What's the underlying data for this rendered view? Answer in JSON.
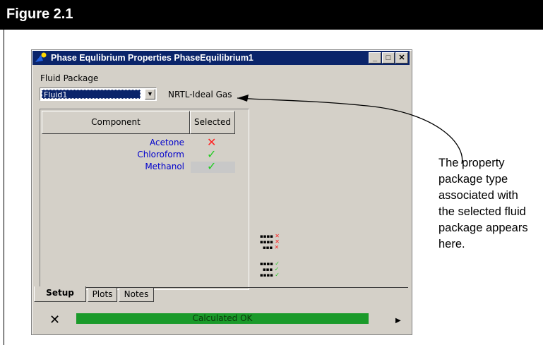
{
  "figure": {
    "title": "Figure 2.1"
  },
  "window": {
    "title": "Phase Equlibrium Properties PhaseEquilibrium1",
    "controls": {
      "minimize": "_",
      "maximize": "□",
      "close": "✕"
    }
  },
  "fluid_package": {
    "label": "Fluid Package",
    "selected": "Fluid1",
    "type": "NRTL-Ideal Gas"
  },
  "table": {
    "headers": [
      "Component",
      "Selected"
    ],
    "rows": [
      {
        "name": "Acetone",
        "mark": "✕",
        "status": "not-selected"
      },
      {
        "name": "Chloroform",
        "mark": "✓",
        "status": "selected"
      },
      {
        "name": "Methanol",
        "mark": "✓",
        "status": "selected"
      }
    ]
  },
  "tabs": [
    "Setup",
    "Plots",
    "Notes"
  ],
  "status": {
    "text": "Calculated OK",
    "color": "#1a9a2a"
  },
  "annotation": "The property package type associated with the selected fluid package appears here."
}
